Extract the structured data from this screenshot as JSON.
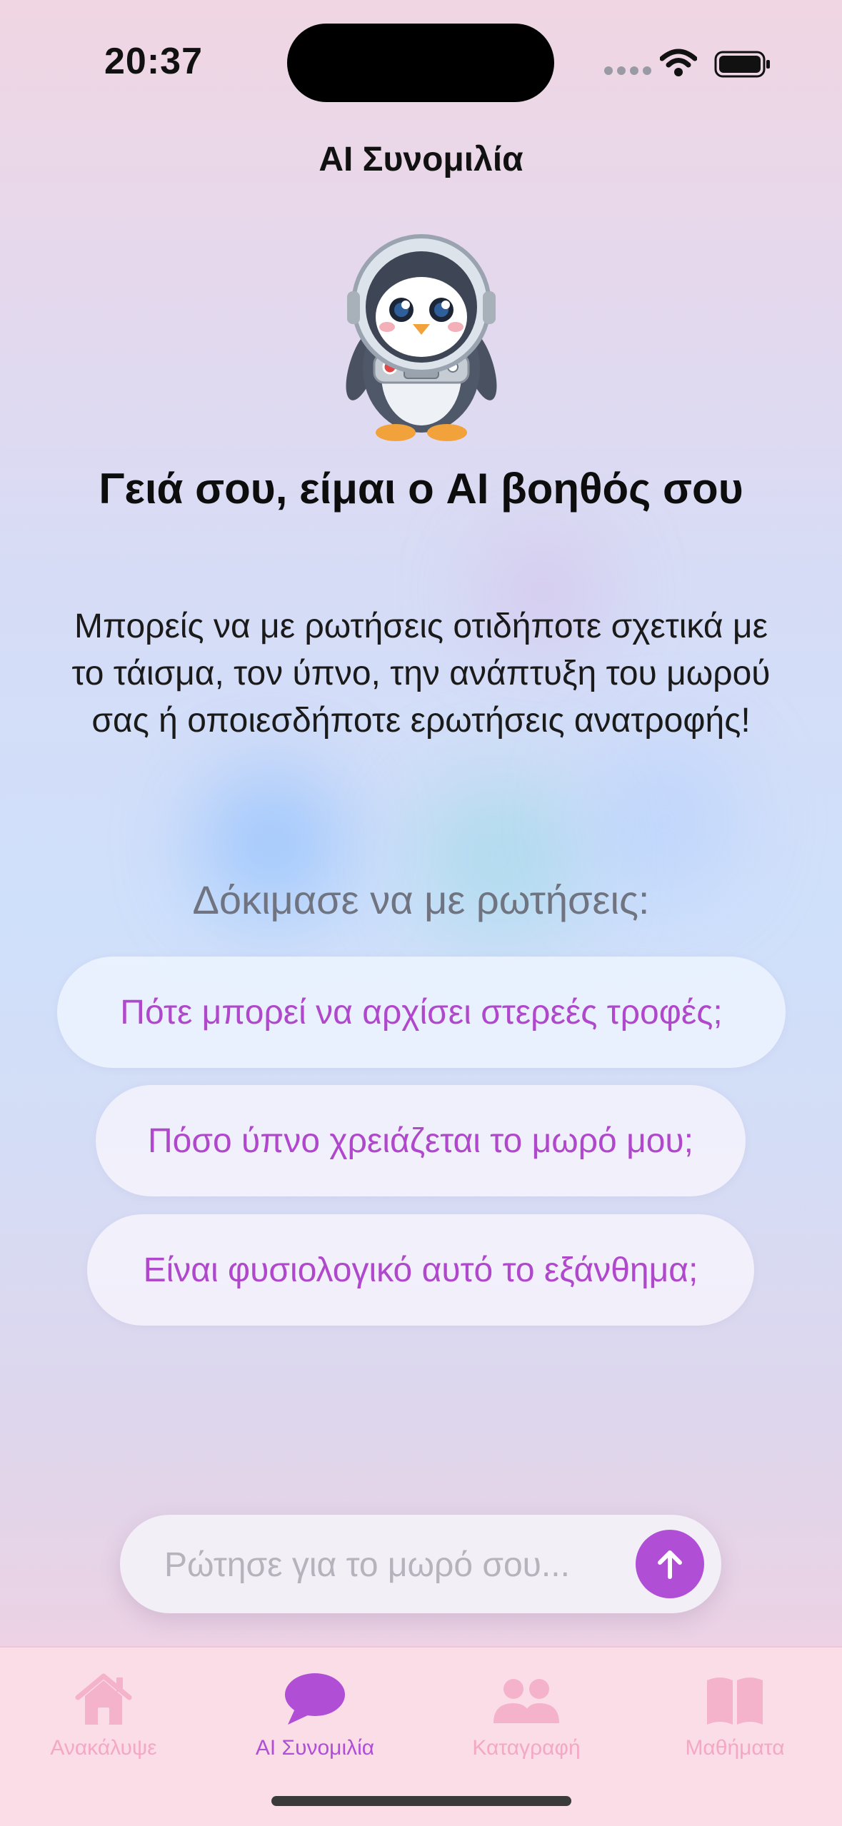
{
  "status_bar": {
    "time": "20:37",
    "icons": [
      "signal-dots-icon",
      "wifi-icon",
      "battery-icon"
    ]
  },
  "header": {
    "title": "AI Συνομιλία"
  },
  "mascot": {
    "description_icon": "astronaut-penguin-icon"
  },
  "main": {
    "greeting": "Γειά σου, είμαι ο AI βοηθός σου",
    "description": "Μπορείς να με ρωτήσεις οτιδήποτε σχετικά με το τάισμα, τον ύπνο, την ανάπτυξη του μωρού σας ή οποιεσδήποτε ερωτήσεις ανατροφής!",
    "suggestions_header": "Δόκιμασε να με ρωτήσεις:",
    "suggestions": [
      "Πότε μπορεί να αρχίσει στερεές τροφές;",
      "Πόσο ύπνο χρειάζεται το μωρό μου;",
      "Είναι φυσιολογικό αυτό το εξάνθημα;"
    ]
  },
  "input": {
    "placeholder": "Ρώτησε για το μωρό σου...",
    "value": "",
    "send_icon": "arrow-up-icon"
  },
  "tab_bar": {
    "tabs": [
      {
        "label": "Ανακάλυψε",
        "icon": "home-icon",
        "active": false
      },
      {
        "label": "AI Συνομιλία",
        "icon": "chat-bubble-icon",
        "active": true
      },
      {
        "label": "Καταγραφή",
        "icon": "people-icon",
        "active": false
      },
      {
        "label": "Μαθήματα",
        "icon": "book-icon",
        "active": false
      }
    ]
  },
  "colors": {
    "accent": "#b04ed6",
    "tab_inactive": "#f3a8c4",
    "tab_bar_bg": "#fbdde8"
  }
}
